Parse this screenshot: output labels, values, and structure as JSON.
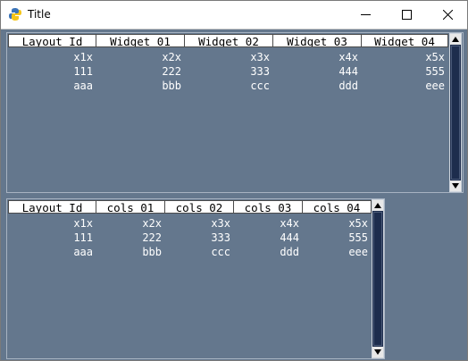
{
  "window": {
    "title": "Title",
    "icon": "python-icon",
    "controls": [
      "minimize-icon",
      "maximize-icon",
      "close-icon"
    ]
  },
  "table1": {
    "headers": [
      "Layout Id",
      "Widget 01",
      "Widget 02",
      "Widget 03",
      "Widget 04"
    ],
    "rows": [
      [
        "x1x",
        "x2x",
        "x3x",
        "x4x",
        "x5x"
      ],
      [
        "111",
        "222",
        "333",
        "444",
        "555"
      ],
      [
        "aaa",
        "bbb",
        "ccc",
        "ddd",
        "eee"
      ]
    ]
  },
  "table2": {
    "headers": [
      "Layout Id",
      "cols 01",
      "cols 02",
      "cols 03",
      "cols 04"
    ],
    "rows": [
      [
        "x1x",
        "x2x",
        "x3x",
        "x4x",
        "x5x"
      ],
      [
        "111",
        "222",
        "333",
        "444",
        "555"
      ],
      [
        "aaa",
        "bbb",
        "ccc",
        "ddd",
        "eee"
      ]
    ]
  },
  "colors": {
    "background": "#64778d",
    "header_bg": "#ffffff",
    "cell_text": "#ffffff",
    "scrollbar": "#1d2d4d"
  }
}
